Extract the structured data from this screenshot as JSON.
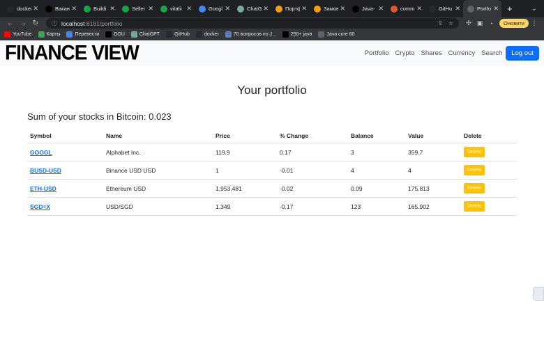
{
  "browser": {
    "tabs": [
      {
        "title": "docker",
        "icon": "github-icon",
        "color": "#24292f"
      },
      {
        "title": "Вакан",
        "icon": "dou-icon",
        "color": "#000000"
      },
      {
        "title": "Buildi",
        "icon": "app-icon",
        "color": "#16a34a"
      },
      {
        "title": "Seller",
        "icon": "app-icon",
        "color": "#16a34a"
      },
      {
        "title": "vitalii",
        "icon": "app-icon",
        "color": "#16a34a"
      },
      {
        "title": "Googl",
        "icon": "google-translate-icon",
        "color": "#4285f4"
      },
      {
        "title": "ChatG",
        "icon": "chatgpt-icon",
        "color": "#74aa9c"
      },
      {
        "title": "Портф",
        "icon": "orange-circle-icon",
        "color": "#f59e0b"
      },
      {
        "title": "Замов",
        "icon": "orange-circle-icon",
        "color": "#f59e0b"
      },
      {
        "title": "Java-",
        "icon": "dou-icon",
        "color": "#000000"
      },
      {
        "title": "comm",
        "icon": "red-circle-icon",
        "color": "#e4572e"
      },
      {
        "title": "GitHu",
        "icon": "github-icon",
        "color": "#24292f"
      },
      {
        "title": "Portfo",
        "icon": "globe-icon",
        "color": "#5f6368",
        "active": true
      }
    ],
    "url_host": "localhost",
    "url_path": ":8181/portfolio",
    "update_label": "Оновити",
    "bookmarks": [
      {
        "label": "YouTube",
        "color": "#ff0000"
      },
      {
        "label": "Карты",
        "color": "#34a853"
      },
      {
        "label": "Перевести",
        "color": "#4285f4"
      },
      {
        "label": "DOU",
        "color": "#000000"
      },
      {
        "label": "ChatGPT",
        "color": "#74aa9c"
      },
      {
        "label": "GitHub",
        "color": "#24292f"
      },
      {
        "label": "docker",
        "color": "#24292f"
      },
      {
        "label": "70 вопросов по J...",
        "color": "#5b7ec5"
      },
      {
        "label": "250+ java",
        "color": "#000000"
      },
      {
        "label": "Java core 60",
        "color": "#5f6368"
      }
    ]
  },
  "navbar": {
    "brand": "FINANCE VIEW",
    "links": [
      "Portfolio",
      "Crypto",
      "Shares",
      "Currency",
      "Search"
    ],
    "logout": "Log out"
  },
  "main": {
    "title": "Your portfolio",
    "sum_label": "Sum of your stocks in Bitcoin: 0.023"
  },
  "table": {
    "headers": [
      "Symbol",
      "Name",
      "Price",
      "% Change",
      "Balance",
      "Value",
      "Delete"
    ],
    "rows": [
      {
        "symbol": "GOOGL",
        "name": "Alphabet Inc.",
        "price": "119.9",
        "change": "0.17",
        "balance": "3",
        "value": "359.7",
        "delete": "Delete"
      },
      {
        "symbol": "BUSD-USD",
        "name": "Binance USD USD",
        "price": "1",
        "change": "-0.01",
        "balance": "4",
        "value": "4",
        "delete": "Delete"
      },
      {
        "symbol": "ETH-USD",
        "name": "Ethereum USD",
        "price": "1,953.481",
        "change": "-0.02",
        "balance": "0.09",
        "value": "175.813",
        "delete": "Delete"
      },
      {
        "symbol": "SGD=X",
        "name": "USD/SGD",
        "price": "1.349",
        "change": "-0.17",
        "balance": "123",
        "value": "165.902",
        "delete": "Delete"
      }
    ]
  },
  "colors": {
    "primary": "#0d6efd",
    "warning": "#ffc107",
    "chrome_dark": "#1f2023"
  }
}
